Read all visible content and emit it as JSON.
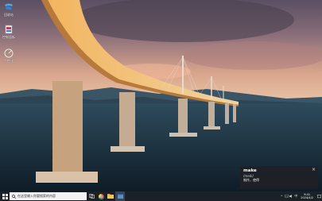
{
  "desktop": {
    "icons": [
      {
        "label": "回收站",
        "icon": "recycle-bin-icon"
      },
      {
        "label": "控制面板",
        "icon": "control-panel-icon"
      },
      {
        "label": "个性化",
        "icon": "personalize-icon"
      }
    ]
  },
  "popup": {
    "word": "make",
    "phonetic": "/meɪk/",
    "meaning": "制作，使得",
    "close_glyph": "×"
  },
  "taskbar": {
    "search_placeholder": "在这里输入你要搜索的内容",
    "apps": [
      "task-view-icon",
      "chrome-icon",
      "file-explorer-icon",
      "app-window-icon"
    ],
    "tray": {
      "lang": "中",
      "time": "9:41",
      "date": "2024/4/2"
    }
  },
  "colors": {
    "taskbar_bg": "#1c2128",
    "popup_bg": "#1e2126",
    "windows_blue": "#1a8fe3"
  }
}
